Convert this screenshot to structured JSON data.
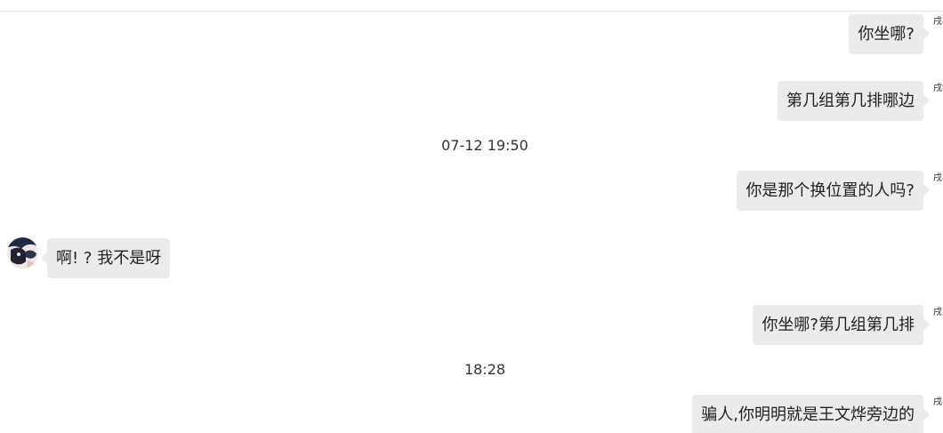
{
  "messages": [
    {
      "text": "你坐哪?",
      "sender": "戌考"
    },
    {
      "text": "第几组第几排哪边",
      "sender": "戌考"
    },
    {
      "text": "你是那个换位置的人吗?",
      "sender": "戌考"
    },
    {
      "text": "啊! ? 我不是呀"
    },
    {
      "text": "你坐哪?第几组第几排",
      "sender": "戌考"
    },
    {
      "text": "骗人,你明明就是王文烨旁边的",
      "sender": "戌考"
    }
  ],
  "timestamps": [
    "07-12 19:50",
    "18:28"
  ],
  "colors": {
    "bubble": "#ebebeb",
    "text": "#222222",
    "timestamp": "#333333",
    "border": "#e6e6e6"
  }
}
